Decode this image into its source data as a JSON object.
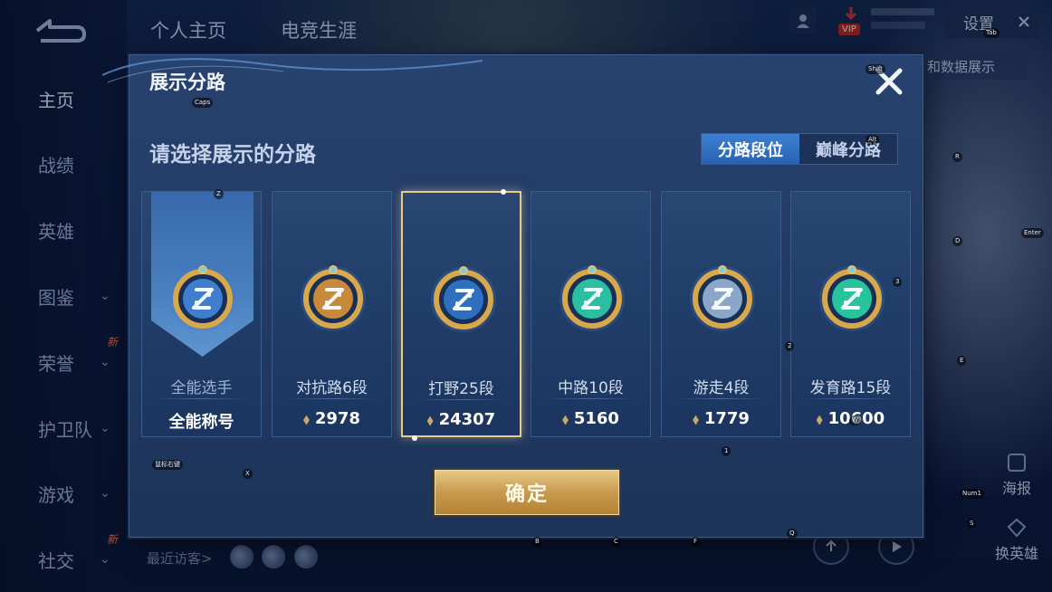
{
  "top_tabs": [
    "个人主页",
    "电竞生涯"
  ],
  "nav": {
    "items": [
      {
        "label": "主页",
        "active": true,
        "chevron": false,
        "new": false
      },
      {
        "label": "战绩",
        "active": false,
        "chevron": false,
        "new": false
      },
      {
        "label": "英雄",
        "active": false,
        "chevron": false,
        "new": false
      },
      {
        "label": "图鉴",
        "active": false,
        "chevron": true,
        "new": false
      },
      {
        "label": "荣誉",
        "active": false,
        "chevron": true,
        "new": true
      },
      {
        "label": "护卫队",
        "active": false,
        "chevron": true,
        "new": false
      },
      {
        "label": "游戏",
        "active": false,
        "chevron": true,
        "new": false
      },
      {
        "label": "社交",
        "active": false,
        "chevron": true,
        "new": true
      }
    ],
    "new_badge": "新"
  },
  "header_right": {
    "settings_label": "设置",
    "vip_label": "VIP",
    "bg_tab_label": "和数据展示"
  },
  "right_side": {
    "poster_label": "海报",
    "switch_hero_label": "换英雄"
  },
  "footer": {
    "recent_visitors": "最近访客>"
  },
  "modal": {
    "title": "展示分路",
    "subtitle": "请选择展示的分路",
    "toggle": [
      "分路段位",
      "巅峰分路"
    ],
    "toggle_active": 0,
    "confirm_label": "确定",
    "cards": [
      {
        "label": "全能选手",
        "value": "全能称号",
        "emblem": "all-round-emblem",
        "color": "#3f7ecf",
        "show_points": false,
        "selected": false,
        "banner": true
      },
      {
        "label": "对抗路6段",
        "value": "2978",
        "emblem": "clash-lane-emblem",
        "color": "#c8893a",
        "show_points": true,
        "selected": false,
        "banner": false
      },
      {
        "label": "打野25段",
        "value": "24307",
        "emblem": "jungle-emblem",
        "color": "#2f6fc0",
        "show_points": true,
        "selected": true,
        "banner": false
      },
      {
        "label": "中路10段",
        "value": "5160",
        "emblem": "mid-lane-emblem",
        "color": "#2bbfa2",
        "show_points": true,
        "selected": false,
        "banner": false
      },
      {
        "label": "游走4段",
        "value": "1779",
        "emblem": "roam-emblem",
        "color": "#8aa6c8",
        "show_points": true,
        "selected": false,
        "banner": false
      },
      {
        "label": "发育路15段",
        "value": "10600",
        "emblem": "farm-lane-emblem",
        "color": "#27c39c",
        "show_points": true,
        "selected": false,
        "banner": false
      }
    ]
  },
  "key_hints": {
    "tab": "Tab",
    "caps": "Caps",
    "shift": "Shift",
    "alt": "Alt",
    "r": "R",
    "z": "Z",
    "enter": "Enter",
    "d": "D",
    "three": "3",
    "two": "2",
    "e": "E",
    "one": "1",
    "mouse_right": "鼠标右键",
    "x": "X",
    "num1": "Num1",
    "s": "S",
    "b": "B",
    "c": "C",
    "f": "F",
    "q": "Q",
    "w": "W"
  },
  "colors": {
    "modal_bg": "#24406b",
    "accent_blue": "#3d7fd3",
    "gold": "#e9c98e",
    "confirm_gold": "#c79a4e"
  }
}
